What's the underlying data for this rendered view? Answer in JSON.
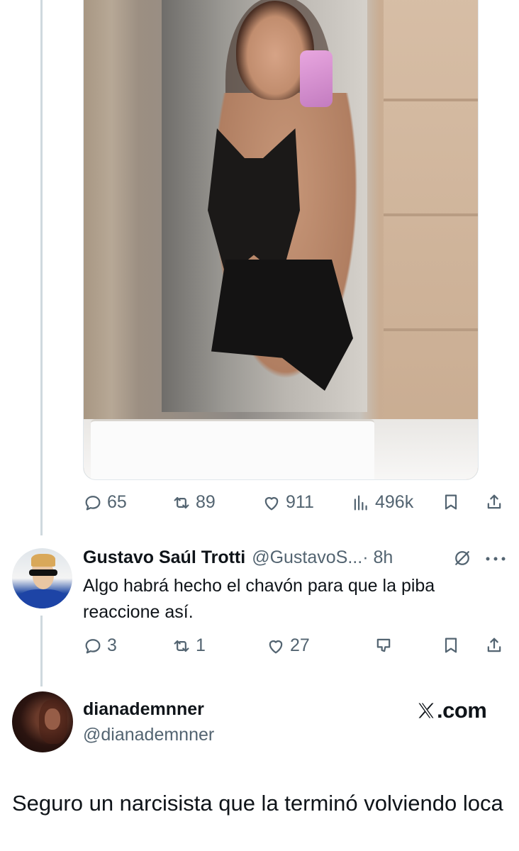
{
  "main_tweet": {
    "stats": {
      "replies": "65",
      "reposts": "89",
      "likes": "911",
      "views": "496k"
    },
    "icons": [
      "reply-icon",
      "repost-icon",
      "like-icon",
      "views-icon",
      "bookmark-icon",
      "share-icon"
    ]
  },
  "reply": {
    "name": "Gustavo Saúl Trotti",
    "handle": "@GustavoS...",
    "time": "· 8h",
    "text": "Algo habrá hecho el chavón para que la piba reaccione así.",
    "stats": {
      "replies": "3",
      "reposts": "1",
      "likes": "27"
    }
  },
  "quoted": {
    "name": "dianademnner",
    "handle": "@dianademnner",
    "brand": ".com",
    "text": "Seguro un narcisista que la terminó volviendo loca"
  },
  "colors": {
    "text": "#0f1419",
    "secondary": "#536471",
    "thread_line": "#cfd9de"
  }
}
